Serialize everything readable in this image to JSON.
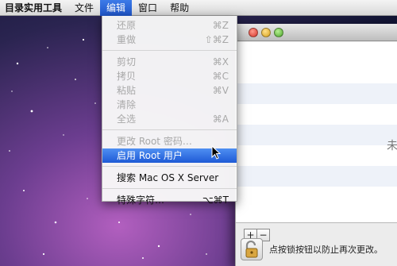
{
  "menubar": {
    "app": "目录实用工具",
    "file": "文件",
    "edit": "编辑",
    "window": "窗口",
    "help": "帮助"
  },
  "edit_menu": {
    "undo": {
      "label": "还原",
      "shortcut": "⌘Z"
    },
    "redo": {
      "label": "重做",
      "shortcut": "⇧⌘Z"
    },
    "cut": {
      "label": "剪切",
      "shortcut": "⌘X"
    },
    "copy": {
      "label": "拷贝",
      "shortcut": "⌘C"
    },
    "paste": {
      "label": "粘贴",
      "shortcut": "⌘V"
    },
    "clear": {
      "label": "清除",
      "shortcut": ""
    },
    "select_all": {
      "label": "全选",
      "shortcut": "⌘A"
    },
    "change_root_password": {
      "label": "更改 Root 密码…",
      "shortcut": ""
    },
    "enable_root_user": {
      "label": "启用 Root 用户",
      "shortcut": ""
    },
    "search_server": {
      "label": "搜索 Mac OS X Server",
      "shortcut": ""
    },
    "special_characters": {
      "label": "特殊字符…",
      "shortcut": "⌥⌘T"
    }
  },
  "window": {
    "partial_text": "未",
    "add_button": "+",
    "remove_button": "−",
    "lock_text": "点按锁按钮以防止再次更改。"
  },
  "colors": {
    "menu_highlight": "#1e5ad6",
    "disabled_text": "#a8a8a8"
  }
}
